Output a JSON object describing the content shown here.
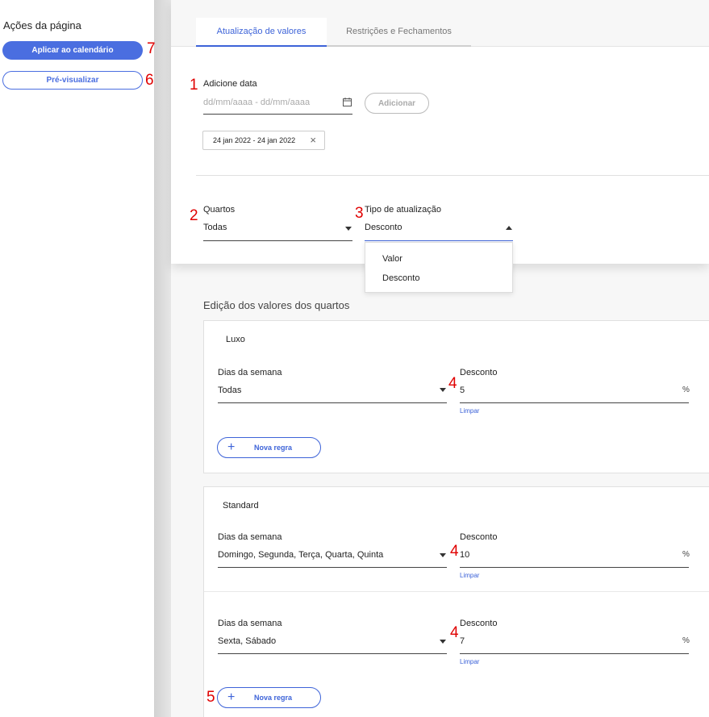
{
  "sidebar": {
    "title": "Ações da página",
    "apply_label": "Aplicar ao calendário",
    "preview_label": "Pré-visualizar"
  },
  "tabs": {
    "values": "Atualização de valores",
    "restrictions": "Restrições e Fechamentos"
  },
  "date": {
    "label": "Adicione data",
    "placeholder": "dd/mm/aaaa - dd/mm/aaaa",
    "add_label": "Adicionar",
    "chip": "24 jan 2022 - 24 jan 2022",
    "chip_close": "×"
  },
  "rooms_select": {
    "label": "Quartos",
    "value": "Todas"
  },
  "update_type": {
    "label": "Tipo de atualização",
    "value": "Desconto",
    "options": [
      "Valor",
      "Desconto"
    ]
  },
  "edit_section": {
    "title": "Edição dos valores dos quartos"
  },
  "cards": [
    {
      "name": "Luxo",
      "rules": [
        {
          "days_label": "Dias da semana",
          "days_value": "Todas",
          "discount_label": "Desconto",
          "discount_value": "5",
          "unit": "%",
          "clear": "Limpar"
        }
      ],
      "new_rule": "Nova regra"
    },
    {
      "name": "Standard",
      "rules": [
        {
          "days_label": "Dias da semana",
          "days_value": "Domingo, Segunda, Terça, Quarta, Quinta",
          "discount_label": "Desconto",
          "discount_value": "10",
          "unit": "%",
          "clear": "Limpar"
        },
        {
          "days_label": "Dias da semana",
          "days_value": "Sexta, Sábado",
          "discount_label": "Desconto",
          "discount_value": "7",
          "unit": "%",
          "clear": "Limpar"
        }
      ],
      "new_rule": "Nova regra"
    }
  ],
  "annotations": {
    "n1": "1",
    "n2": "2",
    "n3": "3",
    "n4a": "4",
    "n4b": "4",
    "n4c": "4",
    "n5": "5",
    "n6": "6",
    "n7": "7"
  },
  "colors": {
    "accent": "#3d63d8",
    "annotation": "#e00000"
  },
  "icons": {
    "calendar": "calendar-icon",
    "close": "close-icon",
    "caret": "caret-down-icon",
    "plus": "plus-icon"
  }
}
